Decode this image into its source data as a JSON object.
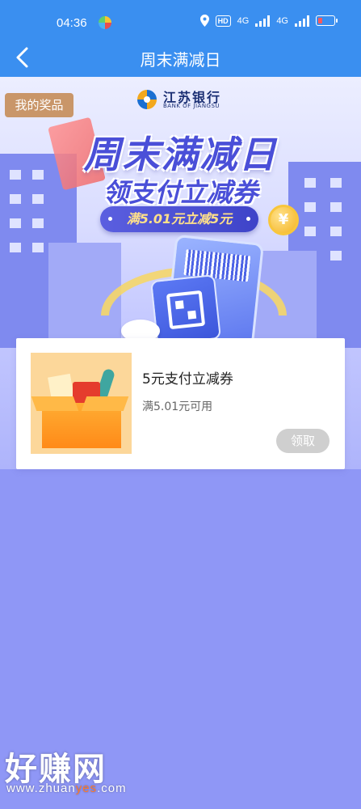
{
  "status_bar": {
    "time": "04:36",
    "hd_label": "HD",
    "network_1": "4G",
    "network_2": "4G"
  },
  "nav": {
    "title": "周末满减日",
    "back_icon": "chevron-left-icon"
  },
  "banner": {
    "prize_badge": "我的奖品",
    "bank_name": "江苏银行",
    "bank_name_en": "BANK OF JIANGSU",
    "title": "周末满减日",
    "subtitle": "领支付立减券",
    "pill": "满5.01元立减5元",
    "coin_symbol": "¥"
  },
  "coupon": {
    "name": "5元支付立减券",
    "condition": "满5.01元可用",
    "button_label": "领取",
    "button_state": "disabled"
  },
  "watermark": {
    "brand": "好赚网",
    "url_prefix": "www.zhuan",
    "url_highlight": "yes",
    "url_suffix": ".com"
  },
  "colors": {
    "nav_bg": "#3a8ff0",
    "page_bg": "#8f97f6",
    "accent": "#4a4fd8",
    "badge_bg": "#c99669",
    "button_disabled": "#cfcfcf"
  }
}
